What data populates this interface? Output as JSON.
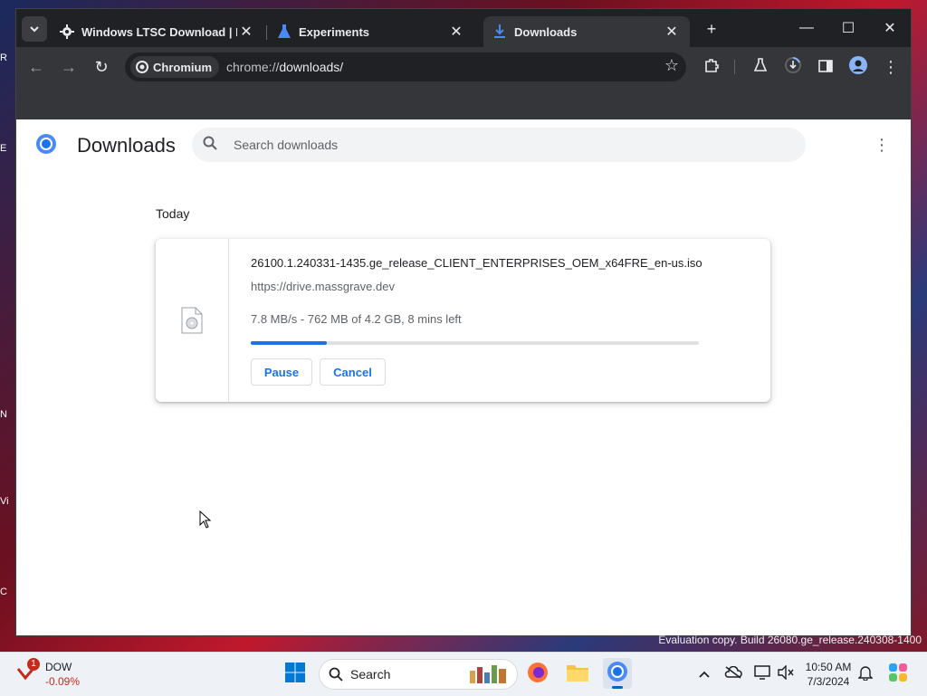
{
  "browser": {
    "tabs": [
      {
        "title": "Windows LTSC Download | MA",
        "icon": "gear-icon",
        "active": false
      },
      {
        "title": "Experiments",
        "icon": "flask-icon",
        "active": false
      },
      {
        "title": "Downloads",
        "icon": "download-icon",
        "active": true
      }
    ],
    "omnibox": {
      "chip_label": "Chromium",
      "url_scheme": "chrome://",
      "url_host": "downloads/"
    }
  },
  "downloads_page": {
    "title": "Downloads",
    "search_placeholder": "Search downloads",
    "date_heading": "Today",
    "items": [
      {
        "filename": "26100.1.240331-1435.ge_release_CLIENT_ENTERPRISES_OEM_x64FRE_en-us.iso",
        "source": "https://drive.massgrave.dev",
        "status": "7.8 MB/s - 762 MB of 4.2 GB, 8 mins left",
        "progress_fraction": 0.17,
        "pause_label": "Pause",
        "cancel_label": "Cancel"
      }
    ]
  },
  "desktop": {
    "watermark": "Evaluation copy. Build 26080.ge_release.240308-1400"
  },
  "taskbar": {
    "stock": {
      "name": "DOW",
      "change": "-0.09%",
      "badge": "1"
    },
    "search_label": "Search",
    "time": "10:50 AM",
    "date": "7/3/2024"
  },
  "colors": {
    "accent": "#1a73e8",
    "titlebar": "#202124",
    "toolbar": "#35363a",
    "stock_negative": "#c42b1c"
  }
}
